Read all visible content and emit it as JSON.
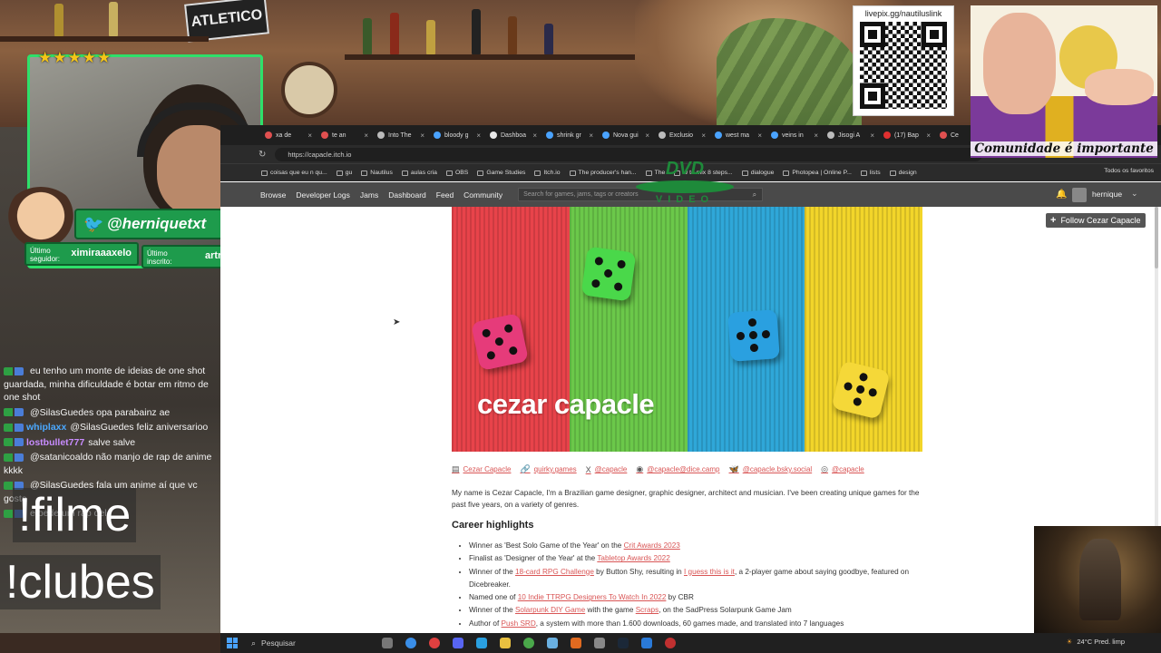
{
  "stream": {
    "banner_text": "ATLETICO",
    "stars": "★★★★★",
    "twitter_handle": "@herniquetxt",
    "last_follower_label": "Último seguidor:",
    "last_follower": "ximiraaaxelo",
    "last_sub_label": "Último inscrito:",
    "last_sub": "artrenan",
    "commands": [
      "!filme",
      "!clubes"
    ],
    "chat": [
      {
        "user": "",
        "color": "#ff4d4d",
        "text": "eu tenho um monte de ideias de one shot guardada, minha dificuldade é botar em ritmo de one shot"
      },
      {
        "user": "",
        "color": "#ff4d4d",
        "text": "@SilasGuedes opa parabainz ae"
      },
      {
        "user": "whiplaxx",
        "color": "#4aa8ff",
        "text": "@SilasGuedes feliz aniversarioo"
      },
      {
        "user": "lostbullet777",
        "color": "#c88cff",
        "text": "salve salve"
      },
      {
        "user": "",
        "color": "#ff4d4d",
        "text": "@satanicoaldo não manjo de rap de anime kkkk"
      },
      {
        "user": "",
        "color": "#ff4d4d",
        "text": "@SilasGuedes fala um anime aí que vc gosta"
      },
      {
        "user": "",
        "color": "#ff4d4d",
        "text": "e pede um rap dele"
      }
    ],
    "qr_label": "livepix.gg/nautiluslink",
    "meme_caption": "Comunidade é importante",
    "dvd_logo": "DVD",
    "dvd_sub": "VIDEO"
  },
  "browser": {
    "tabs": [
      {
        "label": "xa de",
        "color": "#e05050"
      },
      {
        "label": "te an",
        "color": "#e05050"
      },
      {
        "label": "Into The",
        "color": "#bbbbbb"
      },
      {
        "label": "bloody g",
        "color": "#4aa3ff"
      },
      {
        "label": "Dashboa",
        "color": "#e8e8e8"
      },
      {
        "label": "shrink gr",
        "color": "#4aa3ff"
      },
      {
        "label": "Nova gui",
        "color": "#4aa3ff"
      },
      {
        "label": "Exclusio",
        "color": "#bbbbbb"
      },
      {
        "label": "west ma",
        "color": "#4aa3ff"
      },
      {
        "label": "veins in",
        "color": "#4aa3ff"
      },
      {
        "label": "Jisogi A",
        "color": "#bbbbbb"
      },
      {
        "label": "(17) Bap",
        "color": "#e03030"
      },
      {
        "label": "Ce",
        "color": "#e05050"
      }
    ],
    "url": "https://capacle.itch.io",
    "bookmarks": [
      "coisas que eu n qu...",
      "gu",
      "Nautilus",
      "aulas cria",
      "OBS",
      "Game Studies",
      "Itch.io",
      "The producer's han...",
      "The ",
      "w to mix 8 steps...",
      "dialogue",
      "Photopea | Online P...",
      "lists",
      "design"
    ],
    "bookmarks_all": "Todos os favoritos"
  },
  "itch": {
    "nav": [
      "Browse",
      "Developer Logs",
      "Jams",
      "Dashboard",
      "Feed",
      "Community"
    ],
    "search_placeholder": "Search for games, jams, tags or creators",
    "username": "hernique",
    "follow_button": "Follow Cezar Capacle",
    "banner_title": "cezar capacle",
    "banner_colors": [
      "#e8434a",
      "#6bc84a",
      "#2fa7d8",
      "#f2d52a"
    ],
    "socials": [
      {
        "icon": "▤",
        "label": "Cezar Capacle"
      },
      {
        "icon": "🔗",
        "label": "quirky.games"
      },
      {
        "icon": "X",
        "label": "@capacle"
      },
      {
        "icon": "◉",
        "label": "@capacle@dice.camp"
      },
      {
        "icon": "🦋",
        "label": "@capacle.bsky.social"
      },
      {
        "icon": "◎",
        "label": "@capacle"
      }
    ],
    "bio": "My name is Cezar Capacle, I'm a Brazilian game designer, graphic designer, architect and musician. I've been creating unique games for the past five years, on a variety of genres.",
    "career_title": "Career highlights",
    "career": [
      {
        "pre": "Winner as 'Best Solo Game of the Year' on the ",
        "link": "Crit Awards 2023",
        "mid": "",
        "link2": "",
        "post": ""
      },
      {
        "pre": "Finalist as 'Designer of the Year' at the ",
        "link": "Tabletop Awards 2022",
        "mid": "",
        "link2": "",
        "post": ""
      },
      {
        "pre": "Winner of the ",
        "link": "18-card RPG Challenge",
        "mid": " by Button Shy, resulting in ",
        "link2": "I guess this is it",
        "post": ", a 2-player game about saying goodbye, featured on Dicebreaker."
      },
      {
        "pre": "Named one of ",
        "link": "10 Indie TTRPG Designers To Watch In 2022",
        "mid": " by CBR",
        "link2": "",
        "post": ""
      },
      {
        "pre": "Winner of the ",
        "link": "Solarpunk DIY Game",
        "mid": " with the game ",
        "link2": "Scraps",
        "post": ", on the SadPress Solarpunk Game Jam"
      },
      {
        "pre": "Author of ",
        "link": "Push SRD",
        "mid": ", a system with more than 1.600 downloads, 60 games made, and translated into 7 languages",
        "link2": "",
        "post": ""
      }
    ]
  },
  "taskbar": {
    "search_label": "Pesquisar",
    "weather": "24°C Pred. limp"
  }
}
